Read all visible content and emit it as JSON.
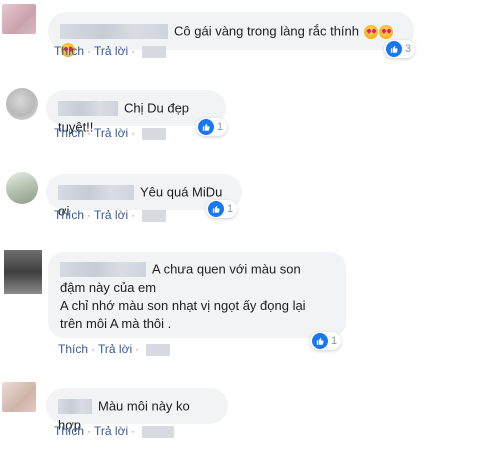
{
  "comments": [
    {
      "text": "Cô gái vàng trong làng rắc thính",
      "emoji": [
        "heart-eyes-emoji",
        "heart-eyes-emoji",
        "heart-eyes-emoji"
      ],
      "actions": {
        "like": "Thích",
        "reply": "Trả lời"
      },
      "reaction_count": "3"
    },
    {
      "text": "Chị Du đẹp tuyệt!!",
      "actions": {
        "like": "Thích",
        "reply": "Trả lời"
      },
      "reaction_count": "1"
    },
    {
      "text": "Yêu quá MiDu ơi",
      "actions": {
        "like": "Thích",
        "reply": "Trả lời"
      },
      "reaction_count": "1"
    },
    {
      "text_lines": [
        "A chưa quen với màu son",
        "đậm này của em",
        "A chỉ nhớ màu son nhạt vị ngọt ấy đọng lại",
        "trên môi A mà thôi ."
      ],
      "actions": {
        "like": "Thích",
        "reply": "Trả lời"
      },
      "reaction_count": "1"
    },
    {
      "text": "Màu môi này ko hợp",
      "actions": {
        "like": "Thích",
        "reply": "Trả lời"
      }
    }
  ],
  "colors": {
    "bubble": "#f2f3f5",
    "link": "#385898",
    "like_blue": "#1877f2"
  },
  "icons": {
    "like": "thumbs-up-icon",
    "emoji": "heart-eyes-emoji"
  }
}
